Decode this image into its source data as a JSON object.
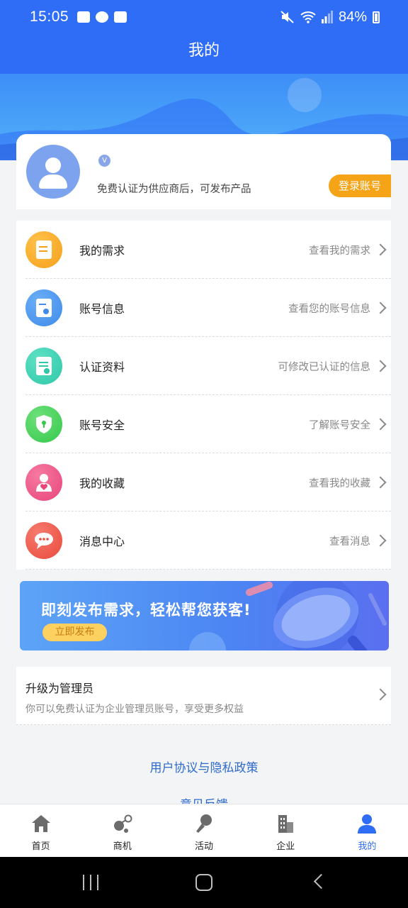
{
  "status_bar": {
    "time": "15:05",
    "battery": "84%",
    "icons": [
      "gallery-icon",
      "cloud-icon",
      "checkbox-icon",
      "mute-icon",
      "wifi-icon",
      "signal-icon",
      "battery-icon"
    ]
  },
  "header": {
    "title": "我的"
  },
  "profile": {
    "cert_tip": "免费认证为供应商后，可发布产品",
    "login_label": "登录账号",
    "verify_mark": "V"
  },
  "menu": {
    "items": [
      {
        "label": "我的需求",
        "hint": "查看我的需求",
        "icon": "document-edit-icon",
        "color": "#f5a01c"
      },
      {
        "label": "账号信息",
        "hint": "查看您的账号信息",
        "icon": "profile-card-icon",
        "color": "#3f8bea"
      },
      {
        "label": "认证资料",
        "hint": "可修改已认证的信息",
        "icon": "certificate-icon",
        "color": "#2ec8a8"
      },
      {
        "label": "账号安全",
        "hint": "了解账号安全",
        "icon": "shield-icon",
        "color": "#35c94c"
      },
      {
        "label": "我的收藏",
        "hint": "查看我的收藏",
        "icon": "favorite-user-icon",
        "color": "#e8457a"
      },
      {
        "label": "消息中心",
        "hint": "查看消息",
        "icon": "chat-bubble-icon",
        "color": "#ea4a3c"
      }
    ]
  },
  "promo": {
    "title": "即刻发布需求，轻松帮您获客!",
    "button": "立即发布"
  },
  "upgrade": {
    "title": "升级为管理员",
    "desc": "你可以免费认证为企业管理员账号，享受更多权益"
  },
  "links": {
    "policy": "用户协议与隐私政策",
    "feedback": "意见反馈"
  },
  "tabs": [
    {
      "label": "首页",
      "icon": "home-icon",
      "active": false
    },
    {
      "label": "商机",
      "icon": "opportunity-icon",
      "active": false
    },
    {
      "label": "活动",
      "icon": "microphone-icon",
      "active": false
    },
    {
      "label": "企业",
      "icon": "building-icon",
      "active": false
    },
    {
      "label": "我的",
      "icon": "user-icon",
      "active": true
    }
  ],
  "colors": {
    "brand": "#2f6df6",
    "accent": "#f6a417",
    "link": "#2f6bcc"
  }
}
